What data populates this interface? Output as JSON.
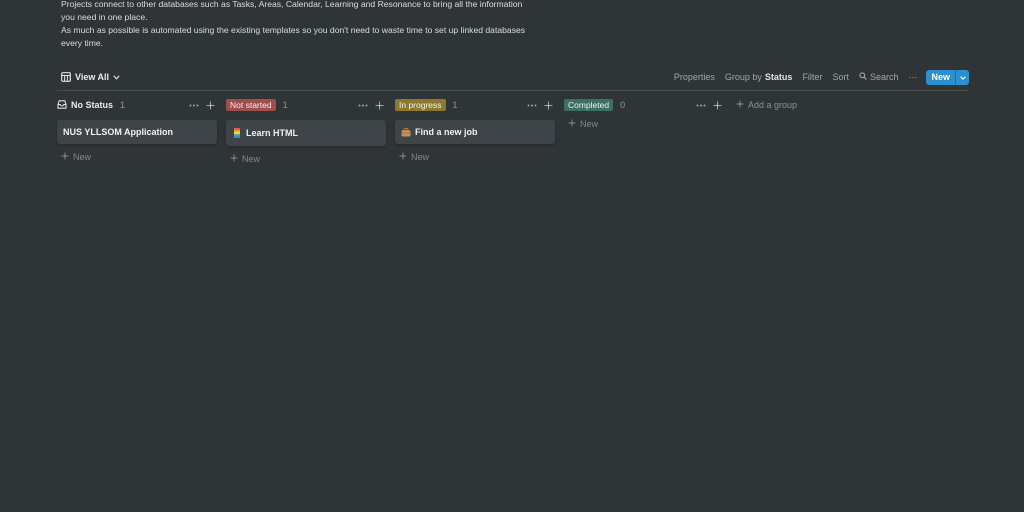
{
  "description": {
    "line1": "Projects connect to other databases such as Tasks, Areas, Calendar, Learning and Resonance to bring all the information you need in one place.",
    "line2": "As much as possible is automated using the existing templates so you don't need to waste time to set up linked databases every time."
  },
  "toolbar": {
    "view_label": "View All",
    "properties": "Properties",
    "group_by_prefix": "Group by",
    "group_by_value": "Status",
    "filter": "Filter",
    "sort": "Sort",
    "search": "Search",
    "more": "···",
    "new_label": "New"
  },
  "columns": [
    {
      "title": "No Status",
      "count": "1",
      "badge_color": "",
      "cards": [
        {
          "title": "NUS YLLSOM Application",
          "icon": ""
        }
      ]
    },
    {
      "title": "Not started",
      "count": "1",
      "badge_color": "#9f4d4d",
      "cards": [
        {
          "title": "Learn HTML",
          "icon": "rainbow-icon"
        }
      ]
    },
    {
      "title": "In progress",
      "count": "1",
      "badge_color": "#8b7a2e",
      "cards": [
        {
          "title": "Find a new job",
          "icon": "briefcase-icon"
        }
      ]
    },
    {
      "title": "Completed",
      "count": "0",
      "badge_color": "#3e6f62",
      "cards": []
    }
  ],
  "new_row_label": "New",
  "add_group_label": "Add a group",
  "colors": {
    "background": "#2f3437",
    "card": "#3f4448",
    "accent": "#2e8fd0"
  }
}
